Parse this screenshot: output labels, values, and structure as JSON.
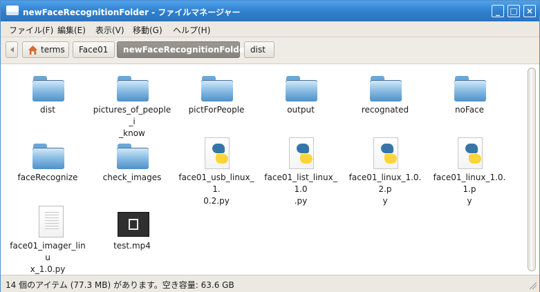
{
  "window": {
    "title": "newFaceRecognitionFolder - ファイルマネージャー",
    "buttons": [
      "_",
      "□",
      "×"
    ]
  },
  "menu": [
    "ファイル(F)",
    "編集(E)",
    "表示(V)",
    "移動(G)",
    "ヘルプ(H)"
  ],
  "path": [
    "terms",
    "Face01",
    "newFaceRecognitionFolder",
    "dist"
  ],
  "files": [
    {
      "name": "dist",
      "type": "folder"
    },
    {
      "name": "pictures_of_people_i_know",
      "type": "folder",
      "display": "pictures_of_people_i\n_know"
    },
    {
      "name": "pictForPeople",
      "type": "folder"
    },
    {
      "name": "output",
      "type": "folder"
    },
    {
      "name": "recognated",
      "type": "folder"
    },
    {
      "name": "noFace",
      "type": "folder"
    },
    {
      "name": "faceRecognize",
      "type": "folder"
    },
    {
      "name": "check_images",
      "type": "folder"
    },
    {
      "name": "face01_usb_linux_1.0.2.py",
      "type": "python",
      "display": "face01_usb_linux_1.\n0.2.py"
    },
    {
      "name": "face01_list_linux_1.0.py",
      "type": "python",
      "display": "face01_list_linux_1.0\n.py"
    },
    {
      "name": "face01_linux_1.0.2.py",
      "type": "python",
      "display": "face01_linux_1.0.2.p\ny"
    },
    {
      "name": "face01_linux_1.0.1.py",
      "type": "python",
      "display": "face01_linux_1.0.1.p\ny"
    },
    {
      "name": "face01_imager_linux_1.0.py",
      "type": "text",
      "display": "face01_imager_linu\nx_1.0.py"
    },
    {
      "name": "test.mp4",
      "type": "video"
    }
  ],
  "status": "14 個のアイテム (77.3 MB) があります。空き容量: 63.6 GB"
}
